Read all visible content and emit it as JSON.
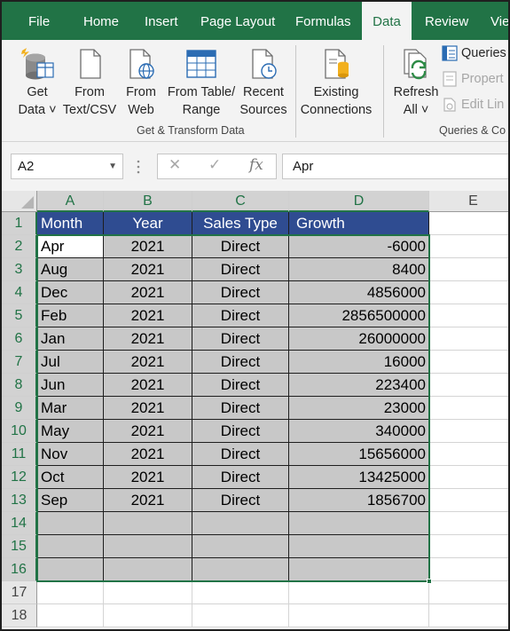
{
  "ribbon_tabs": [
    {
      "label": "File",
      "active": false
    },
    {
      "label": "Home",
      "active": false
    },
    {
      "label": "Insert",
      "active": false
    },
    {
      "label": "Page Layout",
      "active": false
    },
    {
      "label": "Formulas",
      "active": false
    },
    {
      "label": "Data",
      "active": true
    },
    {
      "label": "Review",
      "active": false
    },
    {
      "label": "Vie",
      "active": false
    }
  ],
  "ribbon": {
    "get_data": {
      "line1": "Get",
      "line2": "Data ˅",
      "icon": "database-icon"
    },
    "from_text_csv": {
      "line1": "From",
      "line2": "Text/CSV",
      "icon": "document-icon"
    },
    "from_web": {
      "line1": "From",
      "line2": "Web",
      "icon": "globe-document-icon"
    },
    "from_table_range": {
      "line1": "From Table/",
      "line2": "Range",
      "icon": "table-icon"
    },
    "recent_sources": {
      "line1": "Recent",
      "line2": "Sources",
      "icon": "clock-document-icon"
    },
    "existing_connections": {
      "line1": "Existing",
      "line2": "Connections",
      "icon": "connections-icon"
    },
    "group_get_transform": "Get & Transform Data",
    "refresh_all": {
      "line1": "Refresh",
      "line2": "All ˅",
      "icon": "refresh-icon"
    },
    "queries_connections": "Queries",
    "properties": "Propert",
    "edit_links": "Edit Lin",
    "group_queries": "Queries & Co"
  },
  "formula_bar": {
    "name_box": "A2",
    "cancel_glyph": "✕",
    "enter_glyph": "✓",
    "fx_glyph": "fx",
    "content": "Apr"
  },
  "columns": [
    "A",
    "B",
    "C",
    "D",
    "E"
  ],
  "rows": [
    "1",
    "2",
    "3",
    "4",
    "5",
    "6",
    "7",
    "8",
    "9",
    "10",
    "11",
    "12",
    "13",
    "14",
    "15",
    "16",
    "17",
    "18"
  ],
  "table": {
    "headers": [
      "Month",
      "Year",
      "Sales Type",
      "Growth"
    ],
    "rows": [
      [
        "Apr",
        "2021",
        "Direct",
        "-6000"
      ],
      [
        "Aug",
        "2021",
        "Direct",
        "8400"
      ],
      [
        "Dec",
        "2021",
        "Direct",
        "4856000"
      ],
      [
        "Feb",
        "2021",
        "Direct",
        "2856500000"
      ],
      [
        "Jan",
        "2021",
        "Direct",
        "26000000"
      ],
      [
        "Jul",
        "2021",
        "Direct",
        "16000"
      ],
      [
        "Jun",
        "2021",
        "Direct",
        "223400"
      ],
      [
        "Mar",
        "2021",
        "Direct",
        "23000"
      ],
      [
        "May",
        "2021",
        "Direct",
        "340000"
      ],
      [
        "Nov",
        "2021",
        "Direct",
        "15656000"
      ],
      [
        "Oct",
        "2021",
        "Direct",
        "13425000"
      ],
      [
        "Sep",
        "2021",
        "Direct",
        "1856700"
      ]
    ]
  },
  "colors": {
    "excel_green": "#217346",
    "header_fill": "#2f4c91",
    "data_fill": "#c8c8c8"
  }
}
